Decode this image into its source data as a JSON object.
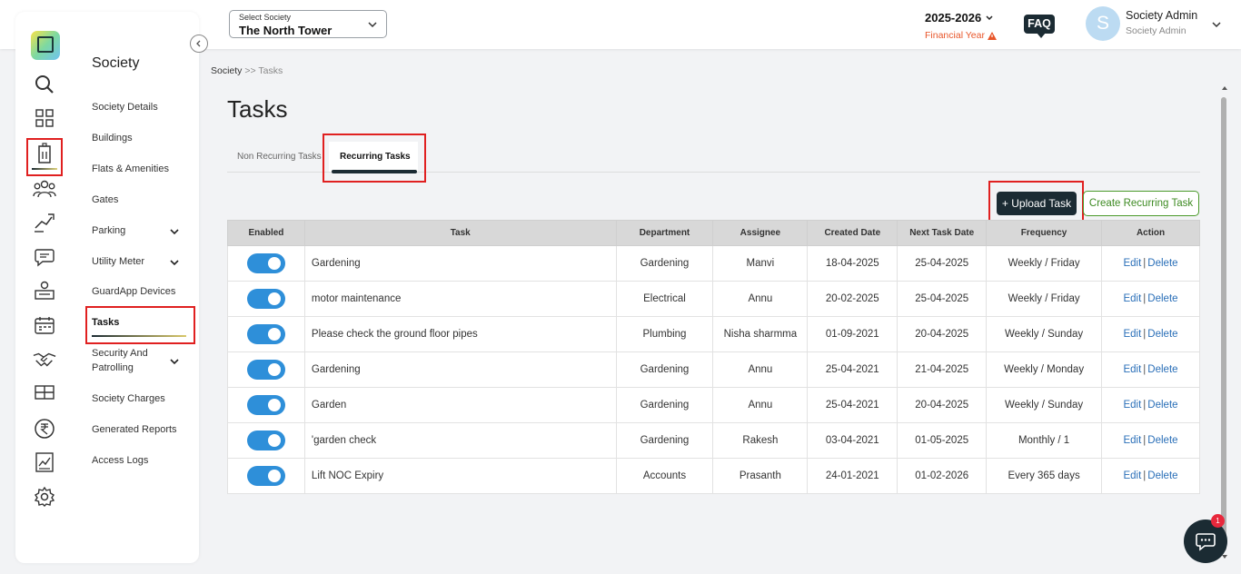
{
  "header": {
    "society_select_label": "Select Society",
    "society_select_value": "The North Tower",
    "financial_year": "2025-2026",
    "financial_year_label": "Financial Year",
    "faq_label": "FAQ",
    "avatar_letter": "S",
    "user_name": "Society Admin",
    "user_role": "Society Admin"
  },
  "sidebar": {
    "title": "Society",
    "items": [
      {
        "label": "Society Details"
      },
      {
        "label": "Buildings"
      },
      {
        "label": "Flats & Amenities"
      },
      {
        "label": "Gates"
      },
      {
        "label": "Parking"
      },
      {
        "label": "Utility Meter"
      },
      {
        "label": "GuardApp Devices"
      },
      {
        "label": "Tasks"
      },
      {
        "label": "Security And"
      },
      {
        "label": "Society Charges"
      },
      {
        "label": "Generated Reports"
      },
      {
        "label": "Access Logs"
      }
    ],
    "security_line2": "Patrolling",
    "rail_icons": [
      "search-icon",
      "dashboard-icon",
      "building-icon",
      "residents-icon",
      "services-icon",
      "chat-icon",
      "helpdesk-icon",
      "calendar-icon",
      "handshake-icon",
      "amenities-icon",
      "rupee-icon",
      "report-icon",
      "settings-icon"
    ]
  },
  "breadcrumb": {
    "root": "Society",
    "sep": ">>",
    "current": "Tasks"
  },
  "page_title": "Tasks",
  "tabs": {
    "non_recurring": "Non Recurring Tasks",
    "recurring": "Recurring Tasks"
  },
  "buttons": {
    "upload": "+ Upload Task",
    "create": "Create Recurring Task"
  },
  "table": {
    "headers": [
      "Enabled",
      "Task",
      "Department",
      "Assignee",
      "Created Date",
      "Next Task Date",
      "Frequency",
      "Action"
    ],
    "rows": [
      {
        "enabled": true,
        "task": "Gardening",
        "department": "Gardening",
        "assignee": "Manvi",
        "created": "18-04-2025",
        "next": "25-04-2025",
        "frequency": "Weekly / Friday",
        "edit": "Edit",
        "delete": "Delete"
      },
      {
        "enabled": true,
        "task": "motor maintenance",
        "department": "Electrical",
        "assignee": "Annu",
        "created": "20-02-2025",
        "next": "25-04-2025",
        "frequency": "Weekly / Friday",
        "edit": "Edit",
        "delete": "Delete"
      },
      {
        "enabled": true,
        "task": "Please check the ground floor pipes",
        "department": "Plumbing",
        "assignee": "Nisha sharmma",
        "created": "01-09-2021",
        "next": "20-04-2025",
        "frequency": "Weekly / Sunday",
        "edit": "Edit",
        "delete": "Delete"
      },
      {
        "enabled": true,
        "task": "Gardening",
        "department": "Gardening",
        "assignee": "Annu",
        "created": "25-04-2021",
        "next": "21-04-2025",
        "frequency": "Weekly / Monday",
        "edit": "Edit",
        "delete": "Delete"
      },
      {
        "enabled": true,
        "task": "Garden",
        "department": "Gardening",
        "assignee": "Annu",
        "created": "25-04-2021",
        "next": "20-04-2025",
        "frequency": "Weekly / Sunday",
        "edit": "Edit",
        "delete": "Delete"
      },
      {
        "enabled": true,
        "task": "'garden check",
        "department": "Gardening",
        "assignee": "Rakesh",
        "created": "03-04-2021",
        "next": "01-05-2025",
        "frequency": "Monthly / 1",
        "edit": "Edit",
        "delete": "Delete"
      },
      {
        "enabled": true,
        "task": "Lift NOC Expiry",
        "department": "Accounts",
        "assignee": "Prasanth",
        "created": "24-01-2021",
        "next": "01-02-2026",
        "frequency": "Every 365 days",
        "edit": "Edit",
        "delete": "Delete"
      }
    ]
  },
  "chat": {
    "badge": "1"
  },
  "colors": {
    "accent": "#1b2b33",
    "toggle": "#2e8fd9",
    "highlight": "#e02020",
    "create_green": "#3d8a22",
    "fy_orange": "#e8562a"
  }
}
